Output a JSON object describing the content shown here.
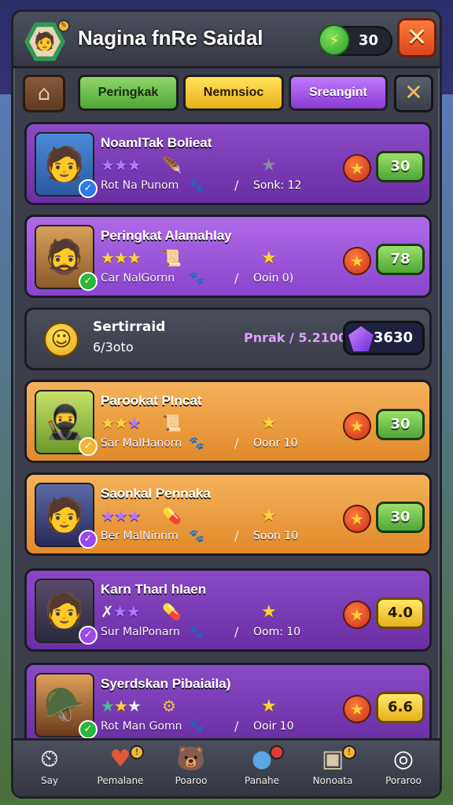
{
  "header": {
    "title": "Nagina fnRe Saidal",
    "energy_value": "30",
    "avatar_badge": "✎"
  },
  "tabs": [
    {
      "label": "Peringkak"
    },
    {
      "label": "Nemnsioc"
    },
    {
      "label": "Sreangint"
    }
  ],
  "players": [
    {
      "name": "NoamlTak Bolieat",
      "sub_left": "Rot Na Punom",
      "sub_right": "Sonk: 12",
      "score": "30",
      "score_style": "green",
      "badge": "✓"
    },
    {
      "name": "Peringkat Alamahlay",
      "sub_left": "Car NalGornn",
      "sub_right": "Ooin 0)",
      "score": "78",
      "score_style": "green",
      "badge": "✓"
    },
    {
      "name": "Parookat PIncat",
      "sub_left": "Sar MalHanorn",
      "sub_right": "Oonr 10",
      "score": "30",
      "score_style": "green",
      "badge": "✓"
    },
    {
      "name": "Saonkal Pennaka",
      "sub_left": "Ber MalNinnm",
      "sub_right": "Soon 10",
      "score": "30",
      "score_style": "green",
      "badge": "✓"
    },
    {
      "name": "Karn Tharl hIaen",
      "sub_left": "Sur MalPonarn",
      "sub_right": "Oom: 10",
      "score": "4.0",
      "score_style": "yellow",
      "badge": "✓"
    },
    {
      "name": "Syerdskan Pibaiaila)",
      "sub_left": "Rot Man Gomn",
      "sub_right": "Ooir 10",
      "score": "6.6",
      "score_style": "yellow",
      "badge": "✓"
    }
  ],
  "summary": {
    "title": "Sertirraid",
    "sub": "6/3oto",
    "rank": "Pnrak / 5.2100",
    "gems": "3630"
  },
  "nav": [
    {
      "label": "Say"
    },
    {
      "label": "Pemalane"
    },
    {
      "label": "Poaroo"
    },
    {
      "label": "Panahe"
    },
    {
      "label": "Nonoata"
    },
    {
      "label": "Poraroo"
    }
  ],
  "colors": {
    "accent_green": "#4ea636",
    "accent_yellow": "#e8b21a",
    "accent_purple": "#8a3ad4",
    "close_red": "#d9441b"
  }
}
